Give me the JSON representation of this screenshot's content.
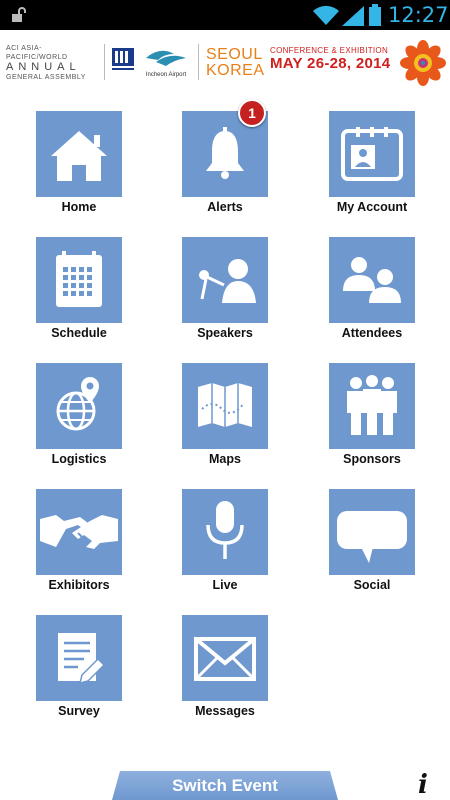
{
  "status_bar": {
    "time": "12:27",
    "accent_color": "#33b5e5"
  },
  "banner": {
    "aci_line1": "ACI ASIA-PACIFIC/WORLD",
    "aci_line2": "ANNUAL",
    "aci_line3": "GENERAL ASSEMBLY",
    "airport_label": "Incheon Airport",
    "seoul": "SEOUL",
    "korea": "KOREA",
    "conference": "CONFERENCE & EXHIBITION",
    "dates": "MAY 26-28, 2014"
  },
  "tiles": [
    {
      "label": "Home",
      "icon": "house-icon"
    },
    {
      "label": "Alerts",
      "icon": "bell-icon"
    },
    {
      "label": "My Account",
      "icon": "id-card-icon"
    },
    {
      "label": "Schedule",
      "icon": "calendar-icon"
    },
    {
      "label": "Speakers",
      "icon": "speaker-icon"
    },
    {
      "label": "Attendees",
      "icon": "people-icon"
    },
    {
      "label": "Logistics",
      "icon": "globe-pin-icon"
    },
    {
      "label": "Maps",
      "icon": "map-icon"
    },
    {
      "label": "Sponsors",
      "icon": "group-icon"
    },
    {
      "label": "Exhibitors",
      "icon": "handshake-icon"
    },
    {
      "label": "Live",
      "icon": "microphone-icon"
    },
    {
      "label": "Social",
      "icon": "speech-bubble-icon"
    },
    {
      "label": "Survey",
      "icon": "survey-icon"
    },
    {
      "label": "Messages",
      "icon": "envelope-icon"
    }
  ],
  "alerts_badge": "1",
  "footer": {
    "switch_event": "Switch Event",
    "info": "i"
  },
  "colors": {
    "tile": "#6f98cf",
    "badge": "#c62121",
    "switch_button": "#7fa3d6"
  }
}
